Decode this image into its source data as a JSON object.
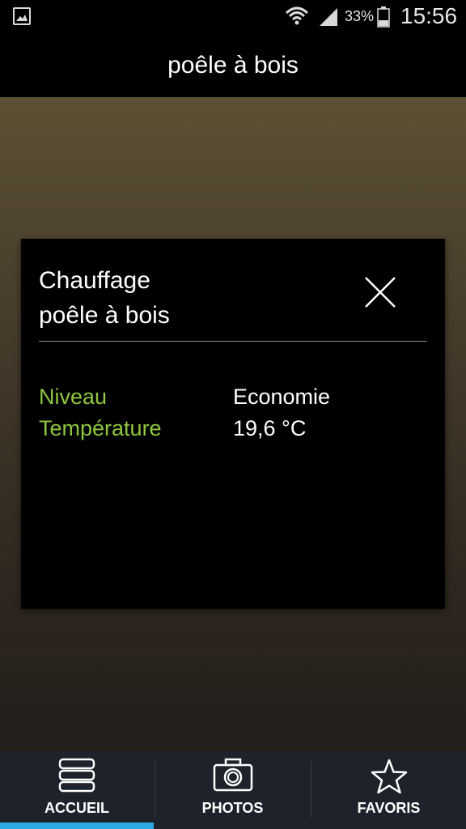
{
  "status_bar": {
    "battery_percent": "33%",
    "time": "15:56",
    "icons": [
      "gallery-notification-icon",
      "wifi-icon",
      "signal-icon",
      "battery-icon"
    ]
  },
  "header": {
    "title": "poêle à bois"
  },
  "dialog": {
    "title": "Chauffage\npoêle à bois",
    "rows": [
      {
        "label": "Niveau",
        "value": "Economie"
      },
      {
        "label": "Température",
        "value": "19,6 °C"
      }
    ]
  },
  "bottom_nav": {
    "tabs": [
      {
        "label": "ACCUEIL",
        "icon": "home-stack-icon",
        "active": true
      },
      {
        "label": "PHOTOS",
        "icon": "camera-icon",
        "active": false
      },
      {
        "label": "FAVORIS",
        "icon": "star-icon",
        "active": false
      }
    ]
  },
  "colors": {
    "accent_label": "#8dc63f",
    "active_tab_indicator": "#29a9e1",
    "nav_background": "#1e232b"
  }
}
